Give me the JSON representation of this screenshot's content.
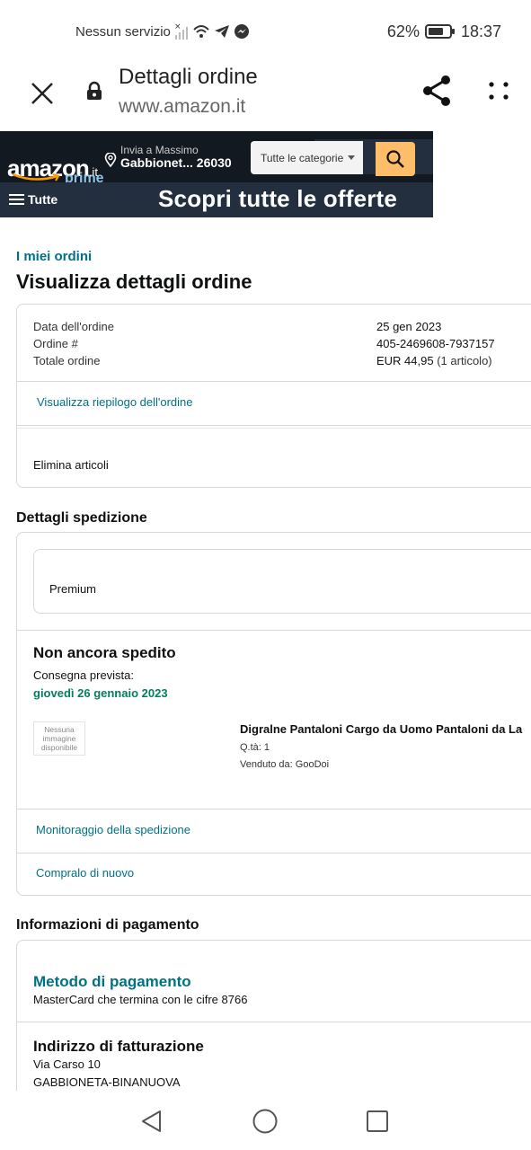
{
  "status_bar": {
    "carrier": "Nessun servizio",
    "battery_percent": "62%",
    "time": "18:37"
  },
  "tab": {
    "title": "Dettagli ordine",
    "url": "www.amazon.it"
  },
  "amazon_header": {
    "logo": "amazon",
    "logo_tld": ".it",
    "prime": "prime",
    "deliver_label": "Invia a Massimo",
    "deliver_location": "Gabbionet... 26030",
    "category_select": "Tutte le categorie",
    "menu_label": "Tutte",
    "banner": "Scopri tutte le offerte"
  },
  "breadcrumb": "I miei ordini",
  "page_title": "Visualizza dettagli ordine",
  "order_summary": {
    "date_label": "Data dell'ordine",
    "date_value": "25 gen 2023",
    "number_label": "Ordine #",
    "number_value": "405-2469608-7937157",
    "total_label": "Totale ordine",
    "total_value": "EUR 44,95",
    "total_items": "(1 articolo)",
    "summary_link": "Visualizza riepilogo dell'ordine",
    "delete_items": "Elimina articoli"
  },
  "shipping": {
    "heading": "Dettagli spedizione",
    "shipping_speed": "Premium",
    "status": "Non ancora spedito",
    "eta_label": "Consegna prevista:",
    "eta_date": "giovedì 26 gennaio 2023",
    "no_image_text": "Nessuna immagine disponibile",
    "product_name": "Digralne Pantaloni Cargo da Uomo Pantaloni da La",
    "product_qty": "Q.tà: 1",
    "product_seller": "Venduto da: GooDoi",
    "track_link": "Monitoraggio della spedizione",
    "buy_again_link": "Compralo di nuovo"
  },
  "payment": {
    "heading": "Informazioni di pagamento",
    "method_title": "Metodo di pagamento",
    "method_detail": "MasterCard che termina con le cifre 8766",
    "billing_title": "Indirizzo di fatturazione",
    "billing_line1": "Via Carso 10",
    "billing_line2": "GABBIONETA-BINANUOVA"
  },
  "colors": {
    "link": "#007185",
    "eta_green": "#067d62",
    "amazon_dark": "#131921",
    "amazon_nav": "#232f3e",
    "search_button": "#febd69"
  }
}
